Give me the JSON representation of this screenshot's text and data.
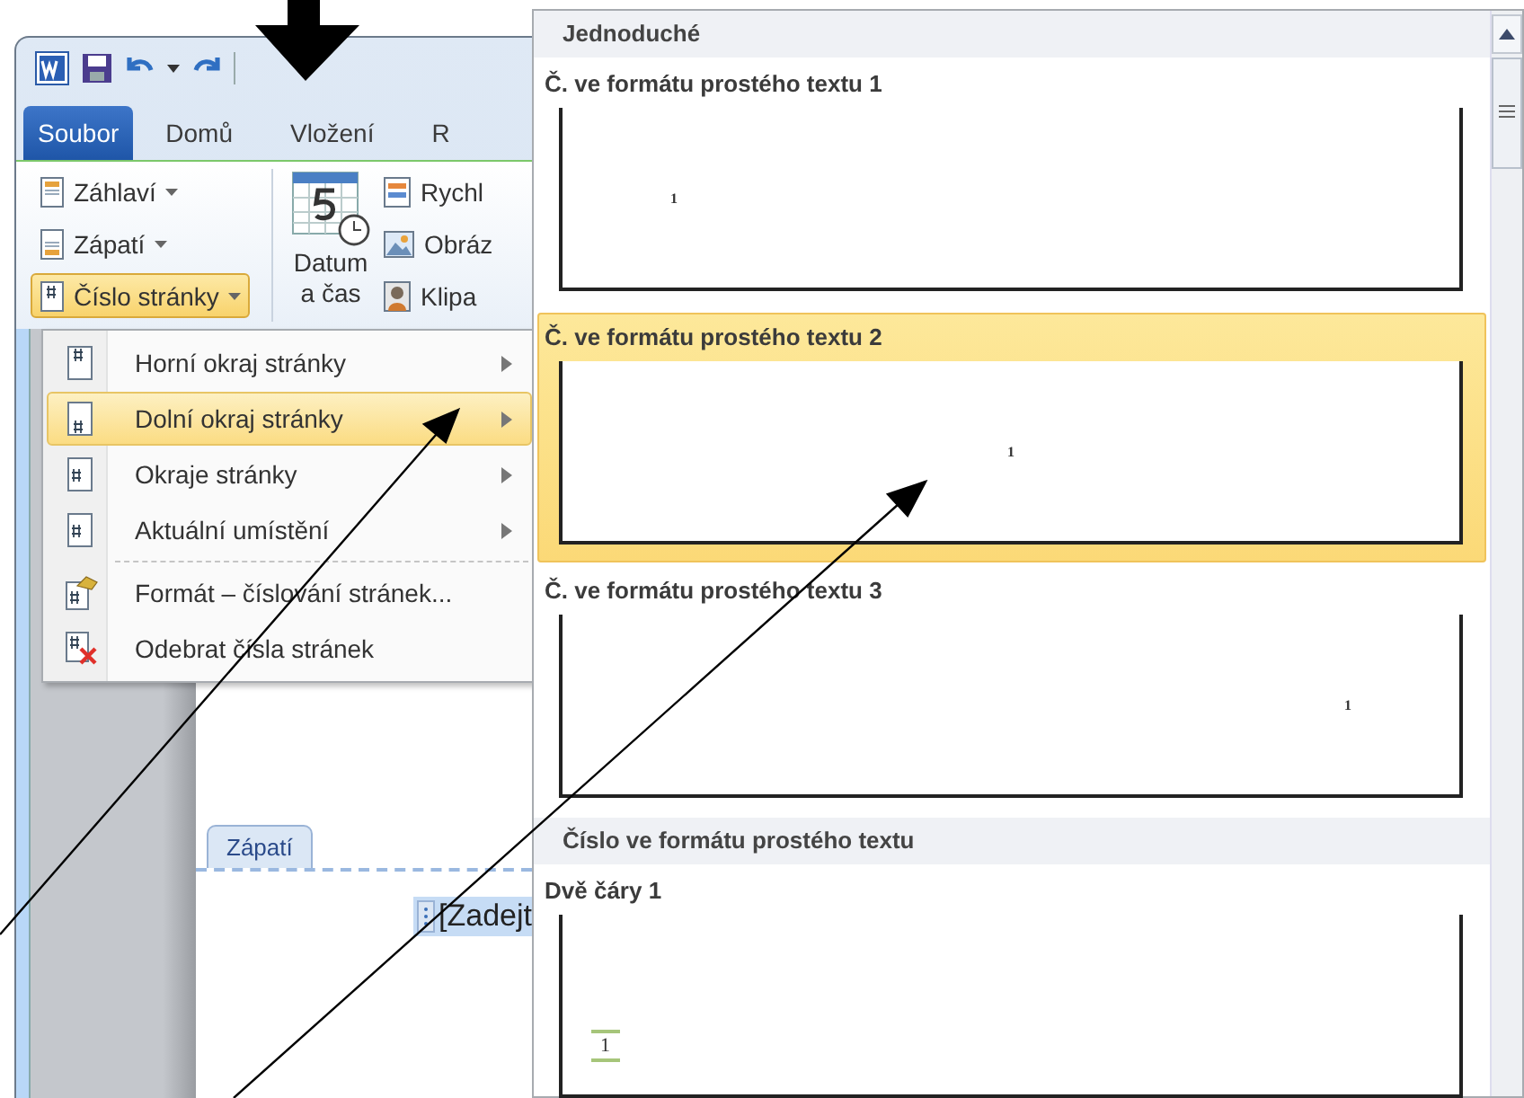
{
  "quick_access": {
    "items": [
      {
        "kind": "app"
      },
      {
        "kind": "save"
      },
      {
        "kind": "undo"
      },
      {
        "kind": "caret"
      },
      {
        "kind": "redo"
      }
    ]
  },
  "tabs": [
    {
      "label": "Soubor",
      "kind": "file"
    },
    {
      "label": "Domů",
      "kind": "tab"
    },
    {
      "label": "Vložení",
      "kind": "tab"
    },
    {
      "label": "R",
      "kind": "tab"
    }
  ],
  "ribbon": {
    "small_buttons": [
      {
        "label": "Záhlaví",
        "pressed": false
      },
      {
        "label": "Zápatí",
        "pressed": false
      },
      {
        "label": "Číslo stránky",
        "pressed": true
      }
    ],
    "date_button": {
      "lines": [
        "Datum",
        "a čas"
      ]
    },
    "cut_buttons": [
      {
        "label": "Rychl"
      },
      {
        "label": "Obráz"
      },
      {
        "label": "Klipa"
      }
    ]
  },
  "menu": {
    "items": [
      {
        "label": "Horní okraj stránky",
        "kind": "submenu",
        "selected": false
      },
      {
        "label": "Dolní okraj stránky",
        "kind": "submenu",
        "selected": true
      },
      {
        "label": "Okraje stránky",
        "kind": "submenu",
        "selected": false
      },
      {
        "label": "Aktuální umístění",
        "kind": "submenu",
        "selected": false
      },
      {
        "label": "Formát – číslování stránek...",
        "kind": "command",
        "selected": false
      },
      {
        "label": "Odebrat čísla stránek",
        "kind": "command",
        "selected": false
      }
    ]
  },
  "document": {
    "footer_tag": "Zápatí",
    "field_text": "[Zadejt"
  },
  "gallery": {
    "sections": [
      {
        "title": "Jednoduché",
        "items": [
          {
            "label": "Č. ve formátu prostého textu 1",
            "kind": "plain-left",
            "number": "1",
            "selected": false
          },
          {
            "label": "Č. ve formátu prostého textu 2",
            "kind": "plain-center",
            "number": "1",
            "selected": true
          },
          {
            "label": "Č. ve formátu prostého textu 3",
            "kind": "plain-right",
            "number": "1",
            "selected": false
          }
        ]
      },
      {
        "title": "Číslo ve formátu prostého textu",
        "items": [
          {
            "label": "Dvě čáry 1",
            "kind": "two-lines",
            "number": "1",
            "selected": false
          }
        ]
      }
    ]
  }
}
